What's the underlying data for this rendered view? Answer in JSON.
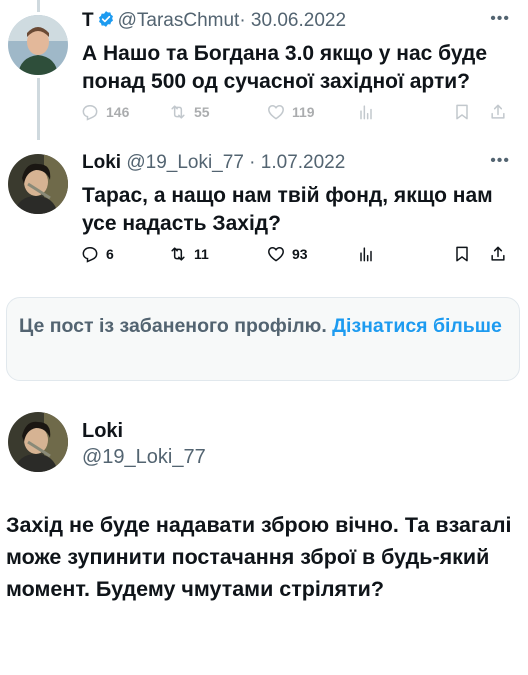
{
  "tweet1": {
    "name": "T",
    "handle": "@TarasChmut",
    "date": "· 30.06.2022",
    "text": "А Нашо та Богдана 3.0 якщо у нас буде понад 500 од сучасної західної арти?",
    "replies": "146",
    "retweets": "55",
    "likes": "119",
    "verified_color": "#1d9bf0"
  },
  "tweet2": {
    "name": "Loki",
    "handle": "@19_Loki_77",
    "date": "· 1.07.2022",
    "text": "Тарас, а нащо нам твій фонд, якщо нам усе надасть Захід?",
    "replies": "6",
    "retweets": "11",
    "likes": "93"
  },
  "banned_notice": {
    "text": "Це пост із забаненого профілю. ",
    "link": "Дізнатися більше"
  },
  "tweet3": {
    "name": "Loki",
    "handle": "@19_Loki_77",
    "text": "Захід не буде надавати зброю вічно. Та взагалі може зупинити постачання зброї в будь-який момент. Будему чмутами стріляти?"
  },
  "icons": [
    "reply-icon",
    "retweet-icon",
    "like-icon",
    "views-icon",
    "bookmark-icon",
    "share-icon",
    "more-icon",
    "verified-icon"
  ]
}
